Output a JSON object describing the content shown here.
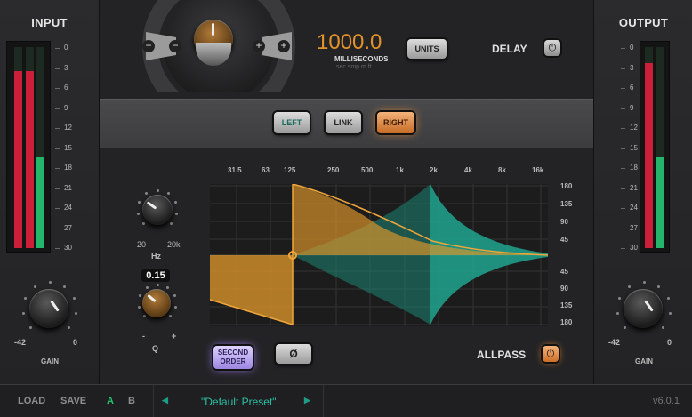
{
  "input": {
    "title": "INPUT",
    "gain_label": "GAIN",
    "gain_min": "-42",
    "gain_max": "0",
    "scale": [
      "0",
      "3",
      "6",
      "9",
      "12",
      "15",
      "18",
      "21",
      "24",
      "27",
      "30"
    ],
    "meter_levels": [
      0.88,
      0.88,
      0.45
    ],
    "meter_colors": [
      "#cc1f3a",
      "#cc1f3a",
      "#23b56a"
    ]
  },
  "output": {
    "title": "OUTPUT",
    "gain_label": "GAIN",
    "gain_min": "-42",
    "gain_max": "0",
    "scale": [
      "0",
      "3",
      "6",
      "9",
      "12",
      "15",
      "18",
      "21",
      "24",
      "27",
      "30"
    ],
    "meter_levels": [
      0.92,
      0.45
    ],
    "meter_colors": [
      "#cc1f3a",
      "#23b56a"
    ]
  },
  "delay": {
    "value": "1000.0",
    "unit": "MILLISECONDS",
    "unit_options": "sec  smp  m  ft",
    "units_button": "UNITS",
    "label": "DELAY",
    "power_glyph": "⏻"
  },
  "channels": {
    "left": "LEFT",
    "link": "LINK",
    "right": "RIGHT",
    "active": "RIGHT"
  },
  "filter": {
    "freq_min": "20",
    "freq_max": "20k",
    "hz_label": "Hz",
    "q_value": "0.15",
    "q_min": "-",
    "q_max": "+",
    "q_label": "Q",
    "second_order": "SECOND ORDER",
    "phase": "Ø",
    "allpass": "ALLPASS",
    "allpass_power": "⏻"
  },
  "graph": {
    "freq_labels": [
      "31.5",
      "63",
      "125",
      "250",
      "500",
      "1k",
      "2k",
      "4k",
      "8k",
      "16k"
    ],
    "phase_labels_top": [
      "180",
      "135",
      "90",
      "45"
    ],
    "phase_labels_bottom": [
      "45",
      "90",
      "135",
      "180"
    ]
  },
  "bottom": {
    "load": "LOAD",
    "save": "SAVE",
    "a": "A",
    "b": "B",
    "prev": "◀",
    "next": "▶",
    "preset": "\"Default Preset\"",
    "version": "v6.0.1"
  },
  "colors": {
    "accent_orange": "#e39a2a",
    "accent_teal": "#1fb79d",
    "green": "#23b56a",
    "red": "#cc1f3a"
  }
}
